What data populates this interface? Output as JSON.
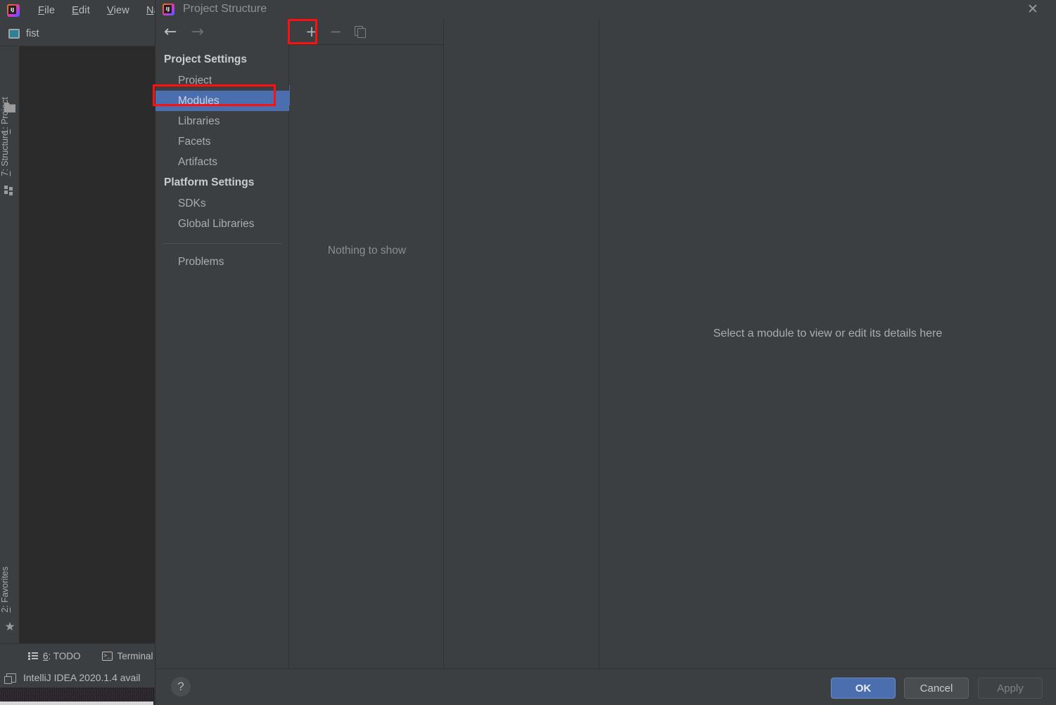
{
  "ide": {
    "logo_icon": "intellij-logo-icon",
    "menu": [
      {
        "label": "File",
        "mnemonic": "F"
      },
      {
        "label": "Edit",
        "mnemonic": "E"
      },
      {
        "label": "View",
        "mnemonic": "V"
      },
      {
        "label": "Navig",
        "mnemonic": "N"
      }
    ],
    "project_bar": {
      "icon": "project-module-icon",
      "name": "fist"
    },
    "left_rail": [
      {
        "label": "1: Project",
        "mnemonic": "1",
        "icon": "folder-icon"
      },
      {
        "label": "7: Structure",
        "mnemonic": "7",
        "icon": "structure-icon"
      },
      {
        "label": "2: Favorites",
        "mnemonic": "2",
        "icon": "star-icon"
      }
    ],
    "status_buttons": [
      {
        "label": "6: TODO",
        "mnemonic": "6",
        "icon": "todo-list-icon"
      },
      {
        "label": "Terminal",
        "mnemonic": "",
        "icon": "terminal-icon"
      }
    ],
    "notification": {
      "icon": "window-icon",
      "text": "IntelliJ IDEA 2020.1.4 avail"
    }
  },
  "dialog": {
    "title": "Project Structure",
    "title_icon": "intellij-logo-icon",
    "close_icon": "✕",
    "nav": {
      "back_icon": "←",
      "forward_icon": "→",
      "groups": [
        {
          "title": "Project Settings",
          "items": [
            {
              "label": "Project",
              "selected": false
            },
            {
              "label": "Modules",
              "selected": true
            },
            {
              "label": "Libraries",
              "selected": false
            },
            {
              "label": "Facets",
              "selected": false
            },
            {
              "label": "Artifacts",
              "selected": false
            }
          ]
        },
        {
          "title": "Platform Settings",
          "items": [
            {
              "label": "SDKs",
              "selected": false
            },
            {
              "label": "Global Libraries",
              "selected": false
            }
          ]
        }
      ],
      "extra_items": [
        {
          "label": "Problems",
          "selected": false
        }
      ]
    },
    "modules_panel": {
      "toolbar": [
        {
          "icon": "plus-icon",
          "label": "+",
          "enabled": true
        },
        {
          "icon": "minus-icon",
          "label": "−",
          "enabled": false
        },
        {
          "icon": "copy-icon",
          "label": "",
          "enabled": false
        }
      ],
      "empty_text": "Nothing to show"
    },
    "detail_panel": {
      "message": "Select a module to view or edit its details here"
    },
    "bottom_bar": {
      "help_label": "?",
      "buttons": [
        {
          "label": "OK",
          "style": "primary"
        },
        {
          "label": "Cancel",
          "style": "default"
        },
        {
          "label": "Apply",
          "style": "disabled"
        }
      ]
    }
  },
  "annotations": {
    "accent_color": "#ff1010",
    "highlights": [
      "add-module-button",
      "sidebar-item-modules"
    ]
  },
  "colors": {
    "window_bg": "#3c3f41",
    "editor_bg": "#2b2b2b",
    "selection_blue": "#4b6eaf",
    "text_primary": "#bbbbbb",
    "text_muted": "#8a8f92"
  }
}
